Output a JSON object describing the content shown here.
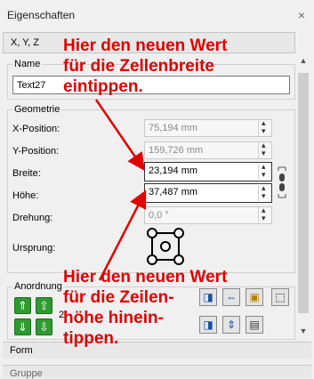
{
  "window": {
    "title": "Eigenschaften",
    "close": "×"
  },
  "tab": {
    "label": "X, Y, Z"
  },
  "name_group": {
    "label": "Name",
    "value": "Text27"
  },
  "geometry": {
    "label": "Geometrie",
    "x_label": "X-Position:",
    "x_value": "75,194 mm",
    "y_label": "Y-Position:",
    "y_value": "159,726 mm",
    "width_label": "Breite:",
    "width_value": "23,194 mm",
    "height_label": "Höhe:",
    "height_value": "37,487 mm",
    "rotation_label": "Drehung:",
    "rotation_value": "0,0 °",
    "origin_label": "Ursprung:"
  },
  "arrangement": {
    "label": "Anordnung",
    "level": "2"
  },
  "sections": {
    "form": "Form",
    "group": "Gruppe"
  },
  "annotations": {
    "top": [
      "Hier den neuen Wert",
      "für die Zellenbreite",
      "eintippen."
    ],
    "bottom": [
      "Hier den neuen Wert",
      "für die Zeilen-",
      "höhe hinein-",
      "tippen."
    ]
  },
  "colors": {
    "annotation": "#e00000",
    "arrow_button": "#2f9a2f"
  }
}
